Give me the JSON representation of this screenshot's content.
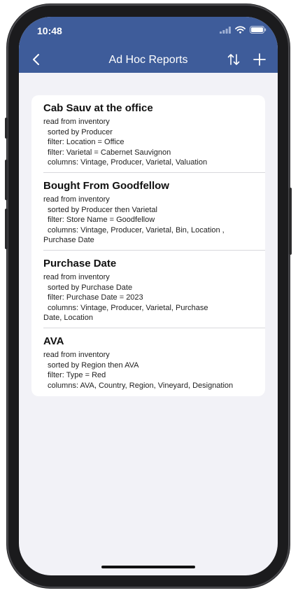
{
  "status": {
    "time": "10:48"
  },
  "nav": {
    "title": "Ad Hoc Reports"
  },
  "reports": [
    {
      "title": "Cab Sauv at the office",
      "lines": [
        "read from inventory",
        "sorted by Producer",
        "filter: Location = Office",
        "filter: Varietal = Cabernet Sauvignon",
        "columns: Vintage, Producer, Varietal, Valuation"
      ]
    },
    {
      "title": "Bought From Goodfellow",
      "lines": [
        "read from inventory",
        "sorted by Producer then Varietal",
        "filter: Store Name = Goodfellow",
        "columns: Vintage, Producer, Varietal, Bin, Location ,",
        "Purchase Date"
      ]
    },
    {
      "title": "Purchase Date",
      "lines": [
        "read from inventory",
        "sorted by Purchase Date",
        "filter: Purchase Date = 2023",
        "columns: Vintage, Producer, Varietal, Purchase",
        "Date, Location"
      ]
    },
    {
      "title": "AVA",
      "lines": [
        "read from inventory",
        "sorted by Region then AVA",
        "filter: Type = Red",
        "columns: AVA, Country, Region, Vineyard, Designation"
      ]
    }
  ]
}
